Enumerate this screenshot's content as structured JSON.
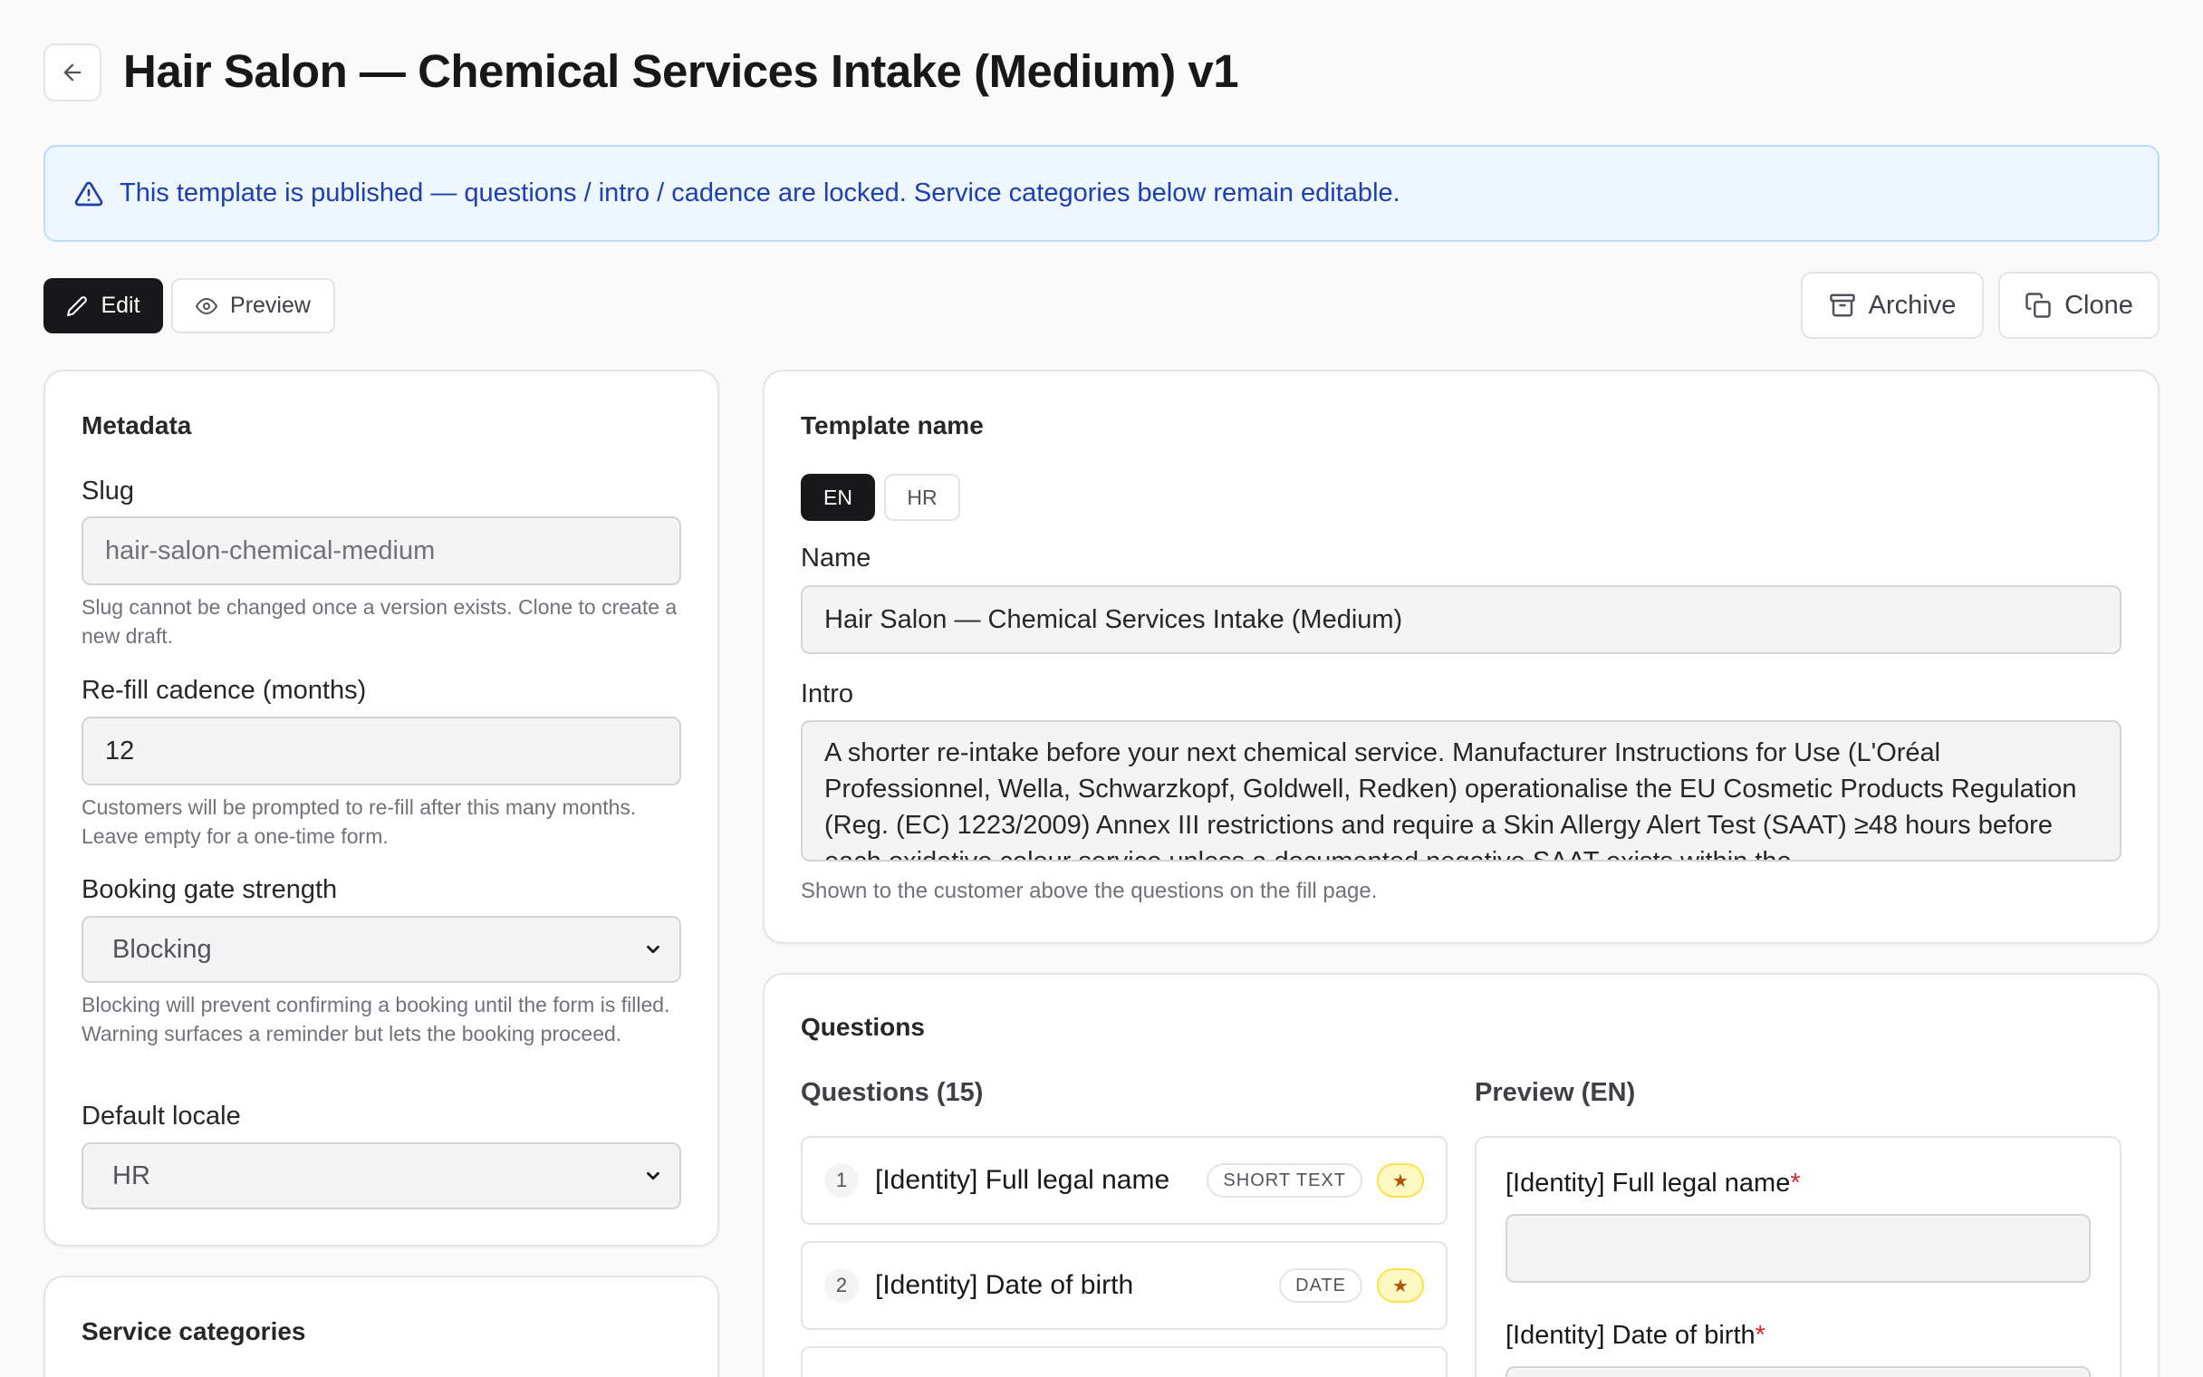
{
  "header": {
    "title": "Hair Salon — Chemical Services Intake (Medium) v1"
  },
  "alert": {
    "message": "This template is published — questions / intro / cadence are locked. Service categories below remain editable."
  },
  "toolbar": {
    "edit_label": "Edit",
    "preview_label": "Preview",
    "archive_label": "Archive",
    "clone_label": "Clone"
  },
  "metadata": {
    "title": "Metadata",
    "slug": {
      "label": "Slug",
      "value": "hair-salon-chemical-medium",
      "help": "Slug cannot be changed once a version exists. Clone to create a new draft."
    },
    "cadence": {
      "label": "Re-fill cadence (months)",
      "value": "12",
      "help": "Customers will be prompted to re-fill after this many months. Leave empty for a one-time form."
    },
    "gate": {
      "label": "Booking gate strength",
      "value": "Blocking",
      "help": "Blocking will prevent confirming a booking until the form is filled. Warning surfaces a reminder but lets the booking proceed."
    },
    "locale": {
      "label": "Default locale",
      "value": "HR"
    }
  },
  "service_categories": {
    "title": "Service categories"
  },
  "template_name": {
    "title": "Template name",
    "locales": [
      "EN",
      "HR"
    ],
    "name_label": "Name",
    "name_value": "Hair Salon — Chemical Services Intake (Medium)",
    "intro_label": "Intro",
    "intro_value": "A shorter re-intake before your next chemical service. Manufacturer Instructions for Use (L'Oréal Professionnel, Wella, Schwarzkopf, Goldwell, Redken) operationalise the EU Cosmetic Products Regulation (Reg. (EC) 1223/2009) Annex III restrictions and require a Skin Allergy Alert Test (SAAT) ≥48 hours before each oxidative colour service unless a documented negative SAAT exists within the",
    "intro_help": "Shown to the customer above the questions on the fill page."
  },
  "questions": {
    "title": "Questions",
    "list_title": "Questions (15)",
    "preview_title": "Preview (EN)",
    "items": [
      {
        "num": "1",
        "label": "[Identity] Full legal name",
        "type": "SHORT TEXT",
        "required_icon": "★"
      },
      {
        "num": "2",
        "label": "[Identity] Date of birth",
        "type": "DATE",
        "required_icon": "★"
      },
      {
        "num": "3",
        "label": "",
        "type": "",
        "required_icon": ""
      }
    ],
    "preview": [
      {
        "label": "[Identity] Full legal name",
        "required_mark": "*"
      },
      {
        "label": "[Identity] Date of birth",
        "required_mark": "*"
      }
    ]
  }
}
